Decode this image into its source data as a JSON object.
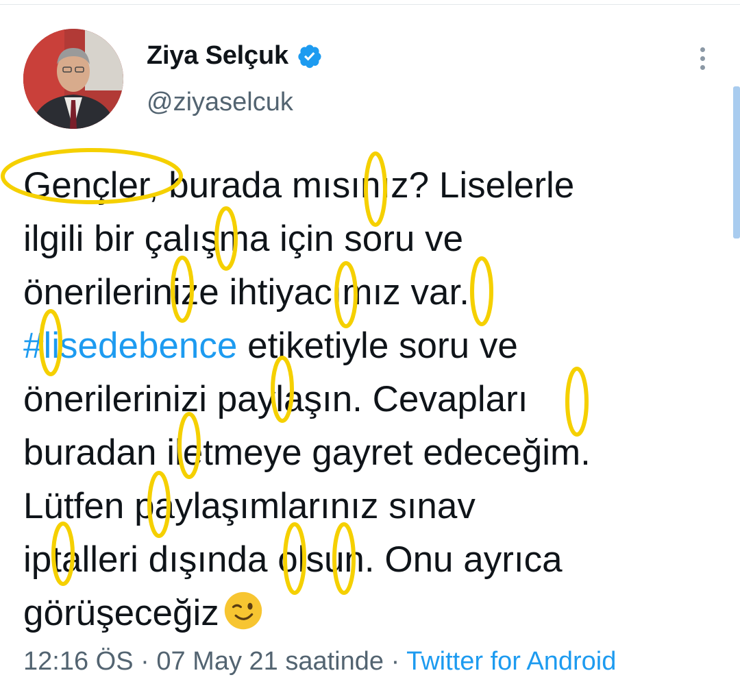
{
  "author": {
    "display_name": "Ziya Selçuk",
    "handle": "@ziyaselcuk",
    "verified": true,
    "avatar_icon": "profile-photo"
  },
  "tweet": {
    "lines": [
      "Gençler, burada mısınız? Liselerle",
      "ilgili bir çalışma için soru ve",
      "önerilerinize ihtiyacımız var.",
      "etiketiyle soru ve",
      "önerilerinizi paylaşın. Cevapları",
      "buradan iletmeye gayret edeceğim.",
      "Lütfen paylaşımlarınız sınav",
      "iptalleri dışında olsun. Onu ayrıca",
      "görüşeceğiz"
    ],
    "hashtag": "#lisedebence",
    "emoji": "winking-face"
  },
  "meta": {
    "time": "12:16 ÖS",
    "separator": " · ",
    "date": "07 May 21 saatinde",
    "source": "Twitter for Android"
  },
  "menu": {
    "icon": "more-vertical-icon"
  },
  "colors": {
    "link": "#1d9bf0",
    "secondary_text": "#536471",
    "annotation": "#f5d000"
  }
}
